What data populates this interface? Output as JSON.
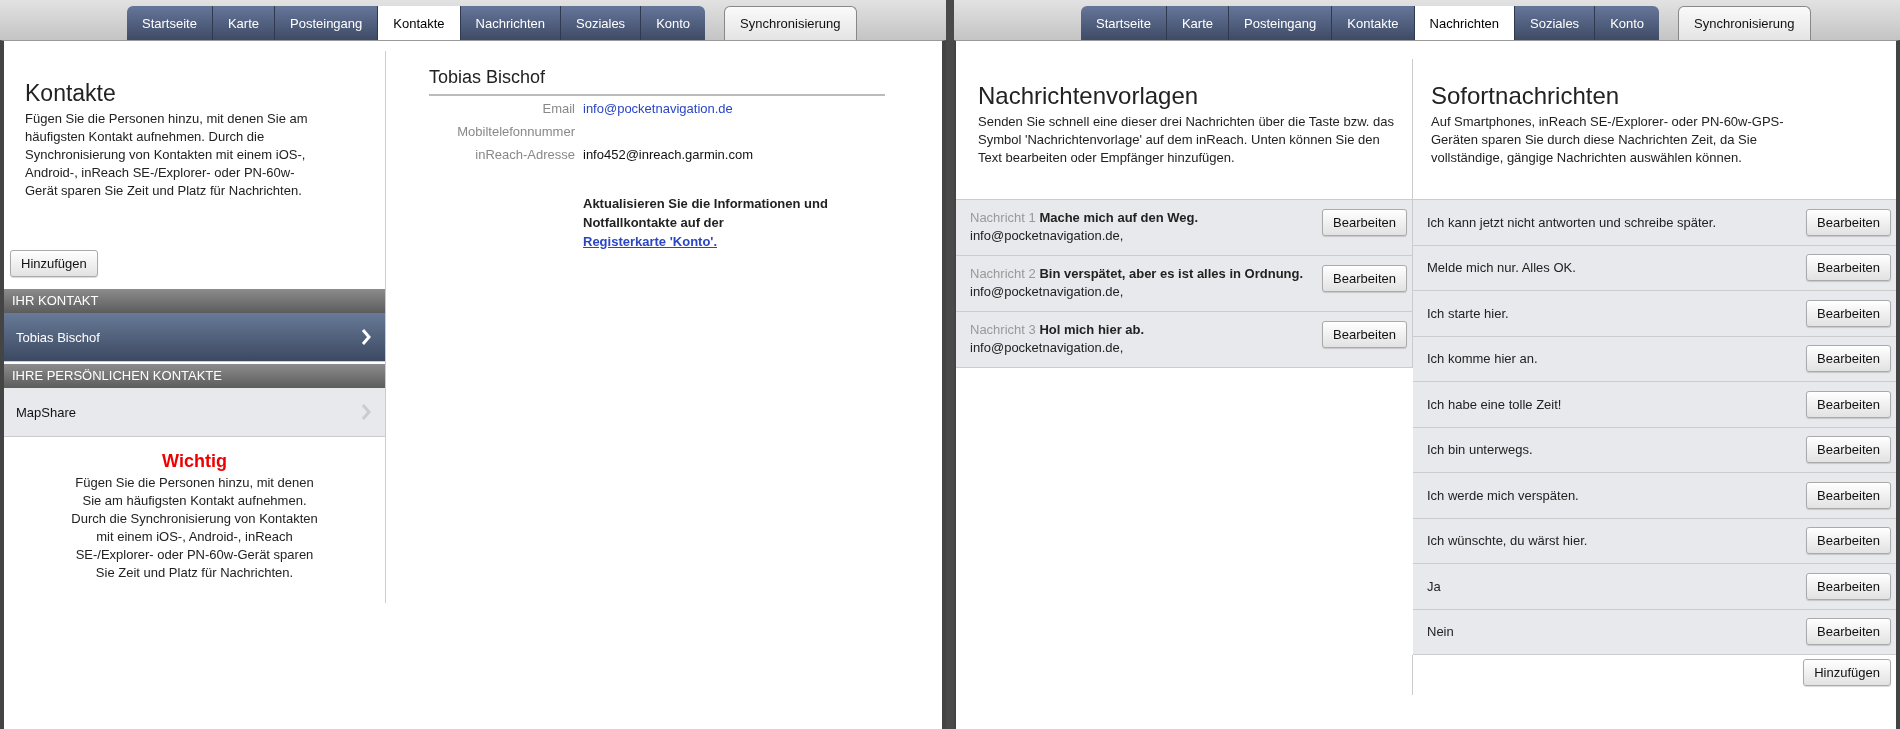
{
  "screens": [
    {
      "kind": "contacts",
      "tabs": [
        {
          "label": "Startseite",
          "selected": false
        },
        {
          "label": "Karte",
          "selected": false
        },
        {
          "label": "Posteingang",
          "selected": false
        },
        {
          "label": "Kontakte",
          "selected": true
        },
        {
          "label": "Nachrichten",
          "selected": false
        },
        {
          "label": "Soziales",
          "selected": false
        },
        {
          "label": "Konto",
          "selected": false
        }
      ],
      "sync_button": "Synchronisierung",
      "sidebar": {
        "title": "Kontakte",
        "description": "Fügen Sie die Personen hinzu, mit denen Sie am häufigsten Kontakt aufnehmen. Durch die Synchronisierung von Kontakten mit einem iOS-, Android-, inReach SE-/Explorer- oder PN-60w-Gerät sparen Sie Zeit und Platz für Nachrichten.",
        "add_button": "Hinzufügen",
        "sections": [
          {
            "heading": "IHR KONTAKT",
            "contacts": [
              {
                "name": "Tobias Bischof",
                "selected": true
              }
            ]
          },
          {
            "heading": "IHRE PERSÖNLICHEN KONTAKTE",
            "contacts": [
              {
                "name": "MapShare",
                "selected": false
              }
            ]
          }
        ],
        "notice": {
          "title": "Wichtig",
          "text": "Fügen Sie die Personen hinzu, mit denen Sie am häufigsten Kontakt aufnehmen. Durch die Synchronisierung von Kontakten mit einem iOS-, Android-, inReach SE-/Explorer- oder PN-60w-Gerät sparen Sie Zeit und Platz für Nachrichten."
        }
      },
      "detail": {
        "name": "Tobias Bischof",
        "fields": [
          {
            "label": "Email",
            "value": "info@pocketnavigation.de",
            "kind": "link"
          },
          {
            "label": "Mobiltelefonnummer"
          },
          {
            "label": "inReach-Adresse",
            "value": "info452@inreach.garmin.com"
          }
        ],
        "note": "Aktualisieren Sie die Informationen und Notfallkontakte auf der",
        "note_link": "Registerkarte 'Konto'."
      }
    },
    {
      "kind": "messages",
      "tabs": [
        {
          "label": "Startseite",
          "selected": false
        },
        {
          "label": "Karte",
          "selected": false
        },
        {
          "label": "Posteingang",
          "selected": false
        },
        {
          "label": "Kontakte",
          "selected": false
        },
        {
          "label": "Nachrichten",
          "selected": true
        },
        {
          "label": "Soziales",
          "selected": false
        },
        {
          "label": "Konto",
          "selected": false
        }
      ],
      "sync_button": "Synchronisierung",
      "templates": {
        "title": "Nachrichtenvorlagen",
        "description": "Senden Sie schnell eine dieser drei Nachrichten über die Taste bzw. das Symbol 'Nachrichtenvorlage' auf dem inReach. Unten können Sie den Text bearbeiten oder Empfänger hinzufügen.",
        "items": [
          {
            "label": "Nachricht 1",
            "message": "Mache mich auf den Weg.",
            "recipients": "info@pocketnavigation.de,",
            "button": "Bearbeiten"
          },
          {
            "label": "Nachricht 2",
            "message": "Bin verspätet, aber es ist alles in Ordnung.",
            "recipients": "info@pocketnavigation.de,",
            "button": "Bearbeiten"
          },
          {
            "label": "Nachricht 3",
            "message": "Hol mich hier ab.",
            "recipients": "info@pocketnavigation.de,",
            "button": "Bearbeiten"
          }
        ]
      },
      "quick": {
        "title": "Sofortnachrichten",
        "description": "Auf Smartphones, inReach SE-/Explorer- oder PN-60w-GPS-Geräten sparen Sie durch diese Nachrichten Zeit, da Sie vollständige, gängige Nachrichten auswählen können.",
        "items": [
          {
            "text": "Ich kann jetzt nicht antworten und schreibe später.",
            "button": "Bearbeiten"
          },
          {
            "text": "Melde mich nur. Alles OK.",
            "button": "Bearbeiten"
          },
          {
            "text": "Ich starte hier.",
            "button": "Bearbeiten"
          },
          {
            "text": "Ich komme hier an.",
            "button": "Bearbeiten"
          },
          {
            "text": "Ich habe eine tolle Zeit!",
            "button": "Bearbeiten"
          },
          {
            "text": "Ich bin unterwegs.",
            "button": "Bearbeiten"
          },
          {
            "text": "Ich werde mich verspäten.",
            "button": "Bearbeiten"
          },
          {
            "text": "Ich wünschte, du wärst hier.",
            "button": "Bearbeiten"
          },
          {
            "text": "Ja",
            "button": "Bearbeiten"
          },
          {
            "text": "Nein",
            "button": "Bearbeiten"
          }
        ],
        "add_button": "Hinzufügen"
      }
    }
  ]
}
